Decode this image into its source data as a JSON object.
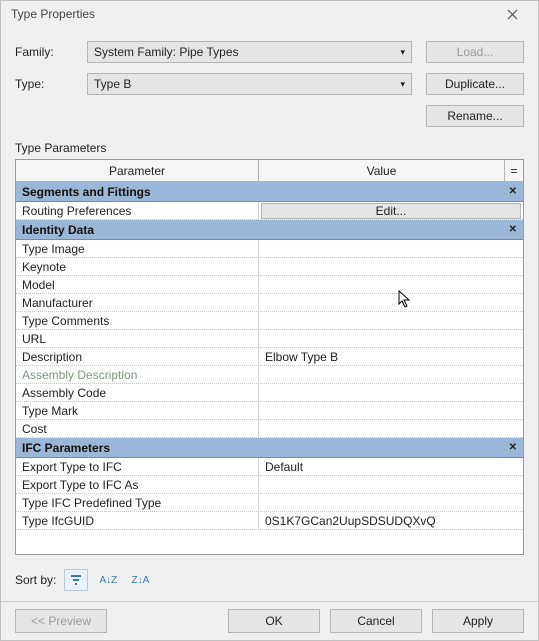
{
  "window": {
    "title": "Type Properties"
  },
  "form": {
    "family_label": "Family:",
    "family_value": "System Family: Pipe Types",
    "type_label": "Type:",
    "type_value": "Type B",
    "load_label": "Load...",
    "duplicate_label": "Duplicate...",
    "rename_label": "Rename..."
  },
  "section": {
    "type_parameters": "Type Parameters"
  },
  "grid": {
    "col_parameter": "Parameter",
    "col_value": "Value",
    "col_eq": "=",
    "groups": [
      {
        "title": "Segments and Fittings",
        "rows": [
          {
            "param": "Routing Preferences",
            "value": "",
            "edit_button": "Edit..."
          }
        ]
      },
      {
        "title": "Identity Data",
        "rows": [
          {
            "param": "Type Image",
            "value": ""
          },
          {
            "param": "Keynote",
            "value": ""
          },
          {
            "param": "Model",
            "value": ""
          },
          {
            "param": "Manufacturer",
            "value": ""
          },
          {
            "param": "Type Comments",
            "value": ""
          },
          {
            "param": "URL",
            "value": ""
          },
          {
            "param": "Description",
            "value": "Elbow Type B"
          },
          {
            "param": "Assembly Description",
            "value": "",
            "dim": true
          },
          {
            "param": "Assembly Code",
            "value": ""
          },
          {
            "param": "Type Mark",
            "value": ""
          },
          {
            "param": "Cost",
            "value": ""
          }
        ]
      },
      {
        "title": "IFC Parameters",
        "rows": [
          {
            "param": "Export Type to IFC",
            "value": "Default"
          },
          {
            "param": "Export Type to IFC As",
            "value": ""
          },
          {
            "param": "Type IFC Predefined Type",
            "value": ""
          },
          {
            "param": "Type IfcGUID",
            "value": "0S1K7GCan2UupSDSUDQXvQ"
          }
        ]
      }
    ]
  },
  "sort": {
    "label": "Sort by:"
  },
  "buttons": {
    "preview": "<< Preview",
    "ok": "OK",
    "cancel": "Cancel",
    "apply": "Apply"
  }
}
